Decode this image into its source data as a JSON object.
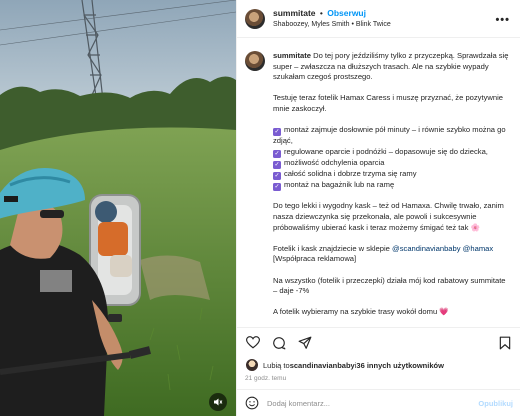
{
  "post": {
    "username": "summitate",
    "follow_label": "Obserwuj",
    "separator": "•",
    "audio_line": "Shaboozey, Myles Smith • Blink Twice",
    "more_label": "•••"
  },
  "caption": {
    "username": "summitate",
    "intro": "Do tej pory jeździliśmy tylko z przyczepką. Sprawdzała się super – zwłaszcza na dłuższych trasach. Ale na szybkie wypady szukałam czegoś prostszego.",
    "para2": "Testuję teraz fotelik Hamax Caress i muszę przyznać, że pozytywnie mnie zaskoczył.",
    "check_mark": "✓",
    "bullets": [
      "montaż zajmuje dosłownie pół minuty – i równie szybko można go zdjąć,",
      "regulowane oparcie i podnóżki – dopasowuje się do dziecka,",
      "możliwość odchylenia oparcia",
      "całość solidna i dobrze trzyma się ramy",
      "montaż na bagażnik lub na ramę"
    ],
    "para3": "Do tego lekki i wygodny kask – też od Hamaxa. Chwilę trwało, zanim nasza dziewczynka się przekonała, ale powoli i sukcesywnie próbowaliśmy ubierać kask i teraz możemy śmigać też tak 🌸",
    "para4_prefix": "Fotelik i kask znajdziecie w sklepie ",
    "mention1": "@scandinavianbaby",
    "mention2": "@hamax",
    "para4_suffix": "[Współpraca reklamowa]",
    "para5": "Na wszystko (fotelik i przeczepki) działa mój kod rabatowy summitate – daje -7%",
    "para6": "A fotelik wybieramy na szybkie trasy wokół domu 💗"
  },
  "likes": {
    "prefix": "Lubią to ",
    "user": "scandinavianbaby",
    "middle": " i ",
    "others": "36 innych użytkowników"
  },
  "time": "21 godz. temu",
  "comment": {
    "placeholder": "Dodaj komentarz...",
    "publish_label": "Opublikuj"
  }
}
